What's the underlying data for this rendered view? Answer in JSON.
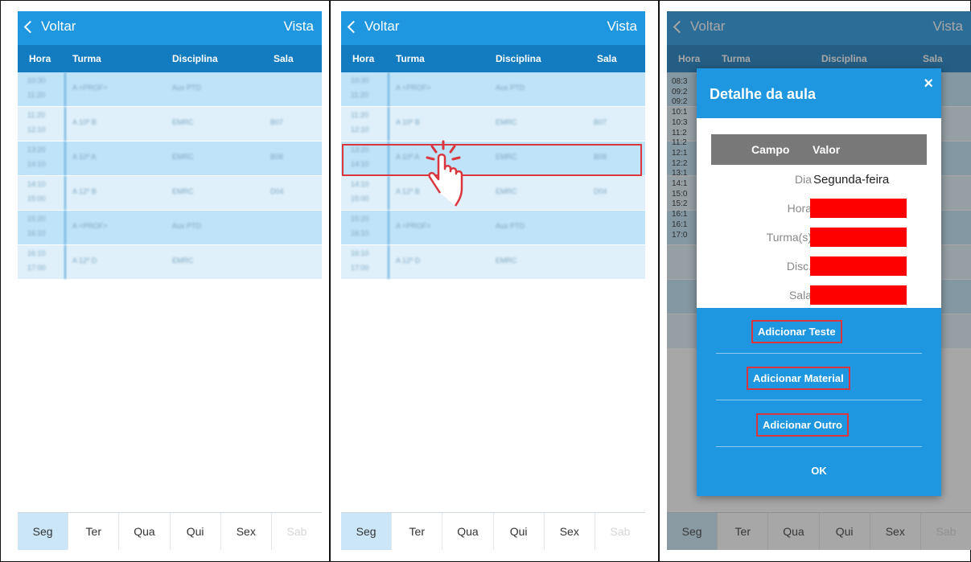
{
  "app": {
    "back_label": "Voltar",
    "view_label": "Vista"
  },
  "columns": [
    "Hora",
    "Turma",
    "Disciplina",
    "Sala"
  ],
  "schedule_rows": [
    {
      "time_start": "10:30",
      "time_end": "11:20",
      "turma": "A <PROF>",
      "disciplina": "Aux PTD",
      "sala": ""
    },
    {
      "time_start": "11:20",
      "time_end": "12:10",
      "turma": "A 10º B",
      "disciplina": "EMRC",
      "sala": "B07"
    },
    {
      "time_start": "13:20",
      "time_end": "14:10",
      "turma": "A 10º A",
      "disciplina": "EMRC",
      "sala": "B08"
    },
    {
      "time_start": "14:10",
      "time_end": "15:00",
      "turma": "A 12º B",
      "disciplina": "EMRC",
      "sala": "D04"
    },
    {
      "time_start": "15:20",
      "time_end": "16:10",
      "turma": "A <PROF>",
      "disciplina": "Aux PTD",
      "sala": ""
    },
    {
      "time_start": "16:10",
      "time_end": "17:00",
      "turma": "A 12º D",
      "disciplina": "EMRC",
      "sala": ""
    }
  ],
  "day_tabs": [
    "Seg",
    "Ter",
    "Qua",
    "Qui",
    "Sex",
    "Sab"
  ],
  "selected_day": "Seg",
  "peek_times": [
    "08:3",
    "09:2",
    "09:2",
    "10:1",
    "10:3",
    "11:2",
    "11:2",
    "12:1",
    "12:2",
    "13:1",
    "14:1",
    "15:0",
    "15:2",
    "16:1",
    "16:1",
    "17:0"
  ],
  "dialog": {
    "title": "Detalhe da aula",
    "close_glyph": "×",
    "table_headers": [
      "Campo",
      "Valor"
    ],
    "fields": [
      {
        "label": "Dia",
        "value": "Segunda-feira"
      },
      {
        "label": "Hora",
        "value": ""
      },
      {
        "label": "Turma(s)",
        "value": ""
      },
      {
        "label": "Disc.",
        "value": ""
      },
      {
        "label": "Sala",
        "value": ""
      }
    ],
    "buttons": [
      "Adicionar Teste",
      "Adicionar Material",
      "Adicionar Outro"
    ],
    "ok_label": "OK"
  },
  "colors": {
    "primary": "#1e96e0",
    "header_dark": "#137bbf",
    "row_light": "#bfe3f8",
    "row_lighter": "#dff0fa",
    "highlight": "#d9363e",
    "redacted": "#ff0000"
  },
  "icons": {
    "back": "chevron-left-icon",
    "tap": "hand-tap-icon",
    "close": "close-icon"
  }
}
